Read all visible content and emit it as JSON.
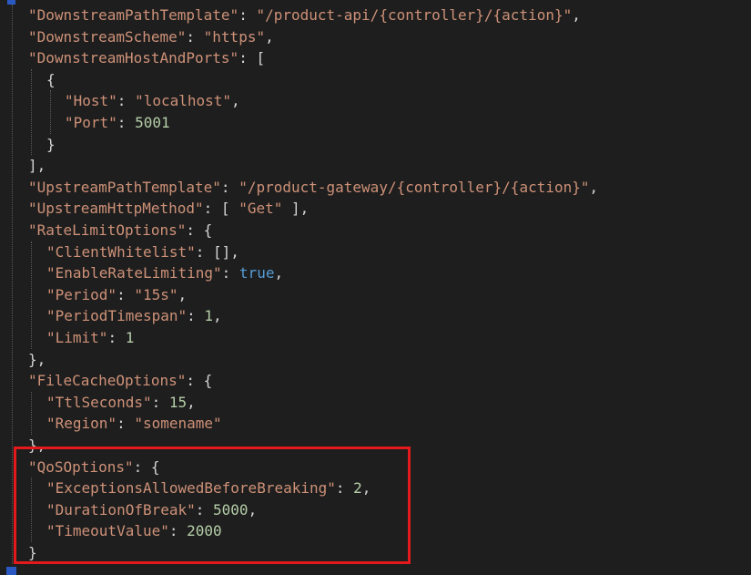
{
  "editor": {
    "lines": [
      {
        "indent": 1,
        "key": "DownstreamPathTemplate",
        "value": "\"/product-api/{controller}/{action}\"",
        "value_type": "str",
        "trail": ","
      },
      {
        "indent": 1,
        "key": "DownstreamScheme",
        "value": "\"https\"",
        "value_type": "str",
        "trail": ","
      },
      {
        "indent": 1,
        "key": "DownstreamHostAndPorts",
        "value": "[",
        "value_type": "punc",
        "trail": ""
      },
      {
        "indent": 2,
        "key": "",
        "value": "{",
        "value_type": "punc",
        "trail": ""
      },
      {
        "indent": 3,
        "key": "Host",
        "value": "\"localhost\"",
        "value_type": "str",
        "trail": ","
      },
      {
        "indent": 3,
        "key": "Port",
        "value": "5001",
        "value_type": "num",
        "trail": ""
      },
      {
        "indent": 2,
        "key": "",
        "value": "}",
        "value_type": "punc",
        "trail": ""
      },
      {
        "indent": 1,
        "key": "",
        "value": "],",
        "value_type": "punc",
        "trail": ""
      },
      {
        "indent": 1,
        "key": "UpstreamPathTemplate",
        "value": "\"/product-gateway/{controller}/{action}\"",
        "value_type": "str",
        "trail": ","
      },
      {
        "indent": 1,
        "key": "UpstreamHttpMethod",
        "value": "[ \"Get\" ]",
        "value_type": "mixed-get",
        "trail": ","
      },
      {
        "indent": 1,
        "key": "RateLimitOptions",
        "value": "{",
        "value_type": "punc",
        "trail": ""
      },
      {
        "indent": 2,
        "key": "ClientWhitelist",
        "value": "[]",
        "value_type": "punc",
        "trail": ","
      },
      {
        "indent": 2,
        "key": "EnableRateLimiting",
        "value": "true",
        "value_type": "bool",
        "trail": ","
      },
      {
        "indent": 2,
        "key": "Period",
        "value": "\"15s\"",
        "value_type": "str",
        "trail": ","
      },
      {
        "indent": 2,
        "key": "PeriodTimespan",
        "value": "1",
        "value_type": "num",
        "trail": ","
      },
      {
        "indent": 2,
        "key": "Limit",
        "value": "1",
        "value_type": "num",
        "trail": ""
      },
      {
        "indent": 1,
        "key": "",
        "value": "},",
        "value_type": "punc",
        "trail": ""
      },
      {
        "indent": 1,
        "key": "FileCacheOptions",
        "value": "{",
        "value_type": "punc",
        "trail": ""
      },
      {
        "indent": 2,
        "key": "TtlSeconds",
        "value": "15",
        "value_type": "num",
        "trail": ","
      },
      {
        "indent": 2,
        "key": "Region",
        "value": "\"somename\"",
        "value_type": "str",
        "trail": ""
      },
      {
        "indent": 1,
        "key": "",
        "value": "},",
        "value_type": "punc",
        "trail": ""
      },
      {
        "indent": 1,
        "key": "QoSOptions",
        "value": "{",
        "value_type": "punc",
        "trail": ""
      },
      {
        "indent": 2,
        "key": "ExceptionsAllowedBeforeBreaking",
        "value": "2",
        "value_type": "num",
        "trail": ","
      },
      {
        "indent": 2,
        "key": "DurationOfBreak",
        "value": "5000",
        "value_type": "num",
        "trail": ","
      },
      {
        "indent": 2,
        "key": "TimeoutValue",
        "value": "2000",
        "value_type": "num",
        "trail": ""
      },
      {
        "indent": 1,
        "key": "",
        "value": "}",
        "value_type": "punc",
        "trail": ""
      }
    ]
  },
  "highlight": {
    "label": "QoSOptions",
    "color": "#e3191b"
  },
  "colors": {
    "background": "#1e1e1e",
    "key": "#9cdcfe",
    "string": "#ce9178",
    "number": "#b5cea8",
    "boolean": "#569cd6",
    "punctuation": "#d4d4d4"
  }
}
